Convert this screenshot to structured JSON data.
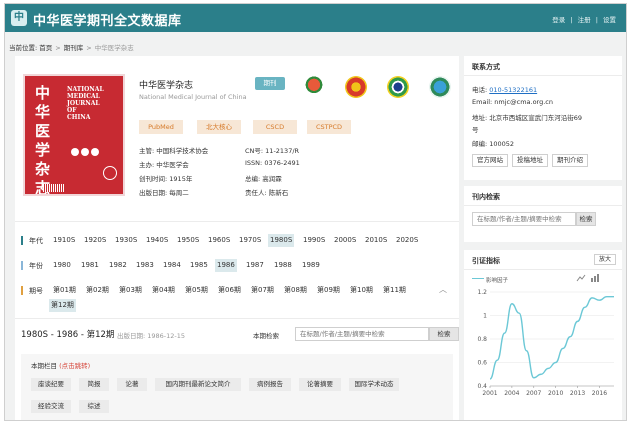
{
  "header": {
    "logo_glyph": "中",
    "site_title": "中华医学期刊全文数据库",
    "links": [
      "登录",
      "注册",
      "设置"
    ],
    "sep": "|"
  },
  "breadcrumb": {
    "label": "当前位置:",
    "items": [
      "首页",
      "期刊库"
    ],
    "current": "中华医学杂志",
    "sep": ">"
  },
  "journal": {
    "cover": {
      "cn": "中华医学杂志",
      "en": [
        "NATIONAL",
        "MEDICAL",
        "JOURNAL",
        "OF",
        "CHINA"
      ]
    },
    "title": "中华医学杂志",
    "title_en": "National Medical Journal of China",
    "type_badge": "期刊",
    "medal_icons": [
      "award-medal-icon",
      "award-badge-icon",
      "award-emblem-icon",
      "award-seal-icon"
    ],
    "indexes": [
      "PubMed",
      "北大核心",
      "CSCD",
      "CSTPCD"
    ],
    "info": [
      {
        "k": "主管:",
        "v": "中国科学技术协会"
      },
      {
        "k": "CN号:",
        "v": "11-2137/R"
      },
      {
        "k": "主办:",
        "v": "中华医学会"
      },
      {
        "k": "ISSN:",
        "v": "0376-2491"
      },
      {
        "k": "创刊时间:",
        "v": "1915年"
      },
      {
        "k": "总编:",
        "v": "高润霖"
      },
      {
        "k": "出版日期:",
        "v": "每周二"
      },
      {
        "k": "责任人:",
        "v": "陈新石"
      }
    ]
  },
  "filters": {
    "decade": {
      "label": "年代",
      "options": [
        "1910S",
        "1920S",
        "1930S",
        "1940S",
        "1950S",
        "1960S",
        "1970S",
        "1980S",
        "1990S",
        "2000S",
        "2010S",
        "2020S"
      ],
      "selected": "1980S"
    },
    "year": {
      "label": "年份",
      "options": [
        "1980",
        "1981",
        "1982",
        "1983",
        "1984",
        "1985",
        "1986",
        "1987",
        "1988",
        "1989"
      ],
      "selected": "1986"
    },
    "issue": {
      "label": "期号",
      "options": [
        "第01期",
        "第02期",
        "第03期",
        "第04期",
        "第05期",
        "第06期",
        "第07期",
        "第08期",
        "第09期",
        "第10期",
        "第11期",
        "第12期"
      ],
      "selected": "第12期"
    }
  },
  "result": {
    "title": "1980S - 1986 - 第12期",
    "date": "出版日期:  1986-12-15",
    "search_label": "本期检索",
    "search_placeholder": "在标题/作者/主题/摘要中检索",
    "search_button": "检索"
  },
  "columns": {
    "head": "本期栏目",
    "hint": "(点击跳转)",
    "tags": [
      "座谈纪要",
      "简报",
      "论著",
      "国内期刊最新论文简介",
      "病例报告",
      "论著摘要",
      "国际学术动态",
      "经验交流",
      "综述"
    ]
  },
  "contact": {
    "title": "联系方式",
    "phone_label": "电话:",
    "phone": "010-51322161",
    "email": "Email:  nmjc@cma.org.cn",
    "addr1": "地址:  北京市西城区宣武门东河沿街69",
    "addr2": "号",
    "postcode": "邮编:  100052",
    "buttons": [
      "官方网站",
      "投稿地址",
      "期刊介绍"
    ]
  },
  "inner_search": {
    "title": "刊内检索",
    "placeholder": "在标题/作者/主题/摘要中检索",
    "button": "检索"
  },
  "citation": {
    "title": "引证指标",
    "more": "放大",
    "legend": "影响因子",
    "chart_icons": [
      "line-chart-icon",
      "bar-chart-icon"
    ]
  },
  "chart_data": {
    "type": "line",
    "series": [
      {
        "name": "影响因子",
        "x": [
          2001,
          2002,
          2003,
          2004,
          2005,
          2006,
          2007,
          2008,
          2009,
          2010,
          2011,
          2012,
          2013,
          2014,
          2015,
          2016,
          2017,
          2018
        ],
        "values": [
          0.46,
          0.62,
          0.85,
          1.1,
          1.02,
          0.7,
          0.47,
          0.5,
          0.55,
          0.6,
          0.72,
          0.82,
          0.95,
          1.07,
          1.15,
          1.13,
          1.16,
          1.16
        ]
      }
    ],
    "xticks": [
      "2001",
      "2004",
      "2007",
      "2010",
      "2013",
      "2016"
    ],
    "yticks": [
      "0.4",
      "0.6",
      "0.8",
      "1",
      "1.2"
    ],
    "ylim": [
      0.4,
      1.2
    ],
    "xlim": [
      2001,
      2018
    ],
    "grid": true,
    "legend": "top-left"
  }
}
